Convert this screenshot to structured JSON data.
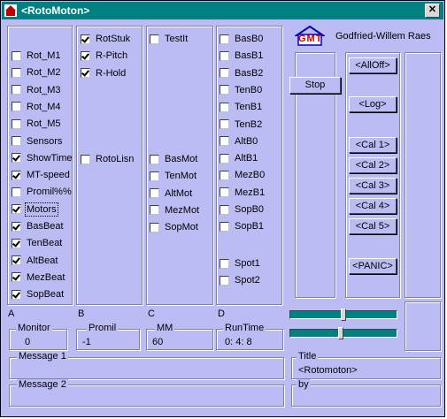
{
  "window": {
    "title": "<RotoMoton>",
    "close_label": "✕"
  },
  "author": "Godfried-Willem Raes",
  "logo_text": "GMT",
  "colA": [
    "Rot_M1",
    "Rot_M2",
    "Rot_M3",
    "Rot_M4",
    "Rot_M5",
    "Sensors",
    "ShowTime",
    "MT-speed",
    "Promil%%",
    "Motors",
    "BasBeat",
    "TenBeat",
    "AltBeat",
    "MezBeat",
    "SopBeat"
  ],
  "colA_checked": [
    false,
    false,
    false,
    false,
    false,
    false,
    true,
    true,
    false,
    true,
    true,
    true,
    true,
    true,
    true
  ],
  "colB_top": [
    "RotStuk",
    "R-Pitch",
    "R-Hold"
  ],
  "colB_top_checked": [
    true,
    true,
    true
  ],
  "colB_mid": "RotoLisn",
  "colC_top": "TestIt",
  "colC": [
    "BasMot",
    "TenMot",
    "AltMot",
    "MezMot",
    "SopMot"
  ],
  "colD_top": [
    "BasB0",
    "BasB1",
    "BasB2",
    "TenB0",
    "TenB1",
    "TenB2",
    "AltB0",
    "AltB1",
    "MezB0",
    "MezB1",
    "SopB0",
    "SopB1"
  ],
  "colD_bottom": [
    "Spot1",
    "Spot2"
  ],
  "section_labels": {
    "a": "A",
    "b": "B",
    "c": "C",
    "d": "D"
  },
  "buttons": {
    "stop": "Stop",
    "alloff": "<AllOff>",
    "log": "<Log>",
    "cal1": "<Cal 1>",
    "cal2": "<Cal 2>",
    "cal3": "<Cal 3>",
    "cal4": "<Cal 4>",
    "cal5": "<Cal 5>",
    "panic": "<PANIC>"
  },
  "sliders": {
    "top_level": 0.5,
    "bottom_level": 0.47
  },
  "readouts": {
    "monitor": {
      "label": "Monitor",
      "value": "0"
    },
    "promil": {
      "label": "Promil",
      "value": "-1"
    },
    "mm": {
      "label": "MM",
      "value": "60"
    },
    "runtime": {
      "label": "RunTime",
      "value": "0: 4: 8"
    }
  },
  "message1": {
    "label": "Message 1",
    "value": ""
  },
  "message2": {
    "label": "Message 2",
    "value": ""
  },
  "title_box": {
    "label": "Title",
    "value": "<Rotomoton>"
  },
  "by_box": {
    "label": "by",
    "value": ""
  }
}
